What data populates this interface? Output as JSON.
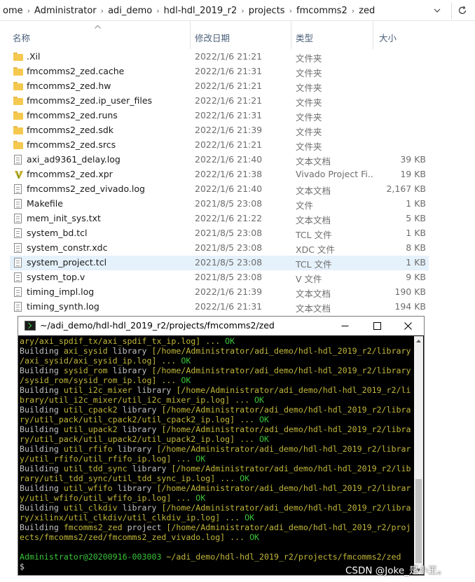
{
  "address": {
    "crumbs": [
      "ome",
      "Administrator",
      "adi_demo",
      "hdl-hdl_2019_r2",
      "projects",
      "fmcomms2",
      "zed"
    ],
    "separator": "›",
    "dropdown_icon": "chevron-down-icon",
    "refresh_icon": "refresh-icon"
  },
  "columns": {
    "name": "名称",
    "date": "修改日期",
    "type": "类型",
    "size": "大小"
  },
  "files": [
    {
      "name": ".Xil",
      "date": "2022/1/6 21:21",
      "type": "文件夹",
      "size": "",
      "icon": "folder-icon"
    },
    {
      "name": "fmcomms2_zed.cache",
      "date": "2022/1/6 21:31",
      "type": "文件夹",
      "size": "",
      "icon": "folder-icon"
    },
    {
      "name": "fmcomms2_zed.hw",
      "date": "2022/1/6 21:21",
      "type": "文件夹",
      "size": "",
      "icon": "folder-icon"
    },
    {
      "name": "fmcomms2_zed.ip_user_files",
      "date": "2022/1/6 21:21",
      "type": "文件夹",
      "size": "",
      "icon": "folder-icon"
    },
    {
      "name": "fmcomms2_zed.runs",
      "date": "2022/1/6 21:31",
      "type": "文件夹",
      "size": "",
      "icon": "folder-icon"
    },
    {
      "name": "fmcomms2_zed.sdk",
      "date": "2022/1/6 21:39",
      "type": "文件夹",
      "size": "",
      "icon": "folder-icon"
    },
    {
      "name": "fmcomms2_zed.srcs",
      "date": "2022/1/6 21:21",
      "type": "文件夹",
      "size": "",
      "icon": "folder-icon"
    },
    {
      "name": "axi_ad9361_delay.log",
      "date": "2022/1/6 21:40",
      "type": "文本文档",
      "size": "39 KB",
      "icon": "document-icon"
    },
    {
      "name": "fmcomms2_zed.xpr",
      "date": "2022/1/6 21:38",
      "type": "Vivado Project Fi...",
      "size": "19 KB",
      "icon": "vivado-icon"
    },
    {
      "name": "fmcomms2_zed_vivado.log",
      "date": "2022/1/6 21:40",
      "type": "文本文档",
      "size": "2,167 KB",
      "icon": "document-icon"
    },
    {
      "name": "Makefile",
      "date": "2021/8/5 23:08",
      "type": "文件",
      "size": "1 KB",
      "icon": "document-icon"
    },
    {
      "name": "mem_init_sys.txt",
      "date": "2022/1/6 21:22",
      "type": "文本文档",
      "size": "5 KB",
      "icon": "document-icon"
    },
    {
      "name": "system_bd.tcl",
      "date": "2021/8/5 23:08",
      "type": "TCL 文件",
      "size": "1 KB",
      "icon": "document-icon"
    },
    {
      "name": "system_constr.xdc",
      "date": "2021/8/5 23:08",
      "type": "XDC 文件",
      "size": "8 KB",
      "icon": "document-icon"
    },
    {
      "name": "system_project.tcl",
      "date": "2021/8/5 23:08",
      "type": "TCL 文件",
      "size": "1 KB",
      "icon": "document-icon",
      "selected": true
    },
    {
      "name": "system_top.v",
      "date": "2021/8/5 23:08",
      "type": "V 文件",
      "size": "9 KB",
      "icon": "document-icon"
    },
    {
      "name": "timing_impl.log",
      "date": "2022/1/6 21:39",
      "type": "文本文档",
      "size": "190 KB",
      "icon": "document-icon"
    },
    {
      "name": "timing_synth.log",
      "date": "2022/1/6 21:31",
      "type": "文本文档",
      "size": "194 KB",
      "icon": "document-icon"
    }
  ],
  "terminal": {
    "title": "~/adi_demo/hdl-hdl_2019_r2/projects/fmcomms2/zed",
    "minimize": "—",
    "maximize": "☐",
    "close": "✕",
    "lines": [
      [
        {
          "t": "ary/axi_spdif_tx/axi_spdif_tx_ip.log] ... ",
          "c": "y"
        },
        {
          "t": "OK",
          "c": "g"
        }
      ],
      [
        {
          "t": "Building ",
          "c": "b"
        },
        {
          "t": "axi_sysid ",
          "c": "y"
        },
        {
          "t": "library ",
          "c": "b"
        },
        {
          "t": "[/home/Administrator/adi_demo/hdl-hdl_2019_r2/library",
          "c": "y"
        }
      ],
      [
        {
          "t": "/axi_sysid/axi_sysid_ip.log] ... ",
          "c": "y"
        },
        {
          "t": "OK",
          "c": "g"
        }
      ],
      [
        {
          "t": "Building ",
          "c": "b"
        },
        {
          "t": "sysid_rom ",
          "c": "y"
        },
        {
          "t": "library ",
          "c": "b"
        },
        {
          "t": "[/home/Administrator/adi_demo/hdl-hdl_2019_r2/library",
          "c": "y"
        }
      ],
      [
        {
          "t": "/sysid_rom/sysid_rom_ip.log] ... ",
          "c": "y"
        },
        {
          "t": "OK",
          "c": "g"
        }
      ],
      [
        {
          "t": "Building ",
          "c": "b"
        },
        {
          "t": "util_i2c_mixer ",
          "c": "y"
        },
        {
          "t": "library ",
          "c": "b"
        },
        {
          "t": "[/home/Administrator/adi_demo/hdl-hdl_2019_r2/li",
          "c": "y"
        }
      ],
      [
        {
          "t": "brary/util_i2c_mixer/util_i2c_mixer_ip.log] ... ",
          "c": "y"
        },
        {
          "t": "OK",
          "c": "g"
        }
      ],
      [
        {
          "t": "Building ",
          "c": "b"
        },
        {
          "t": "util_cpack2 ",
          "c": "y"
        },
        {
          "t": "library ",
          "c": "b"
        },
        {
          "t": "[/home/Administrator/adi_demo/hdl-hdl_2019_r2/libra",
          "c": "y"
        }
      ],
      [
        {
          "t": "ry/util_pack/util_cpack2/util_cpack2_ip.log] ... ",
          "c": "y"
        },
        {
          "t": "OK",
          "c": "g"
        }
      ],
      [
        {
          "t": "Building ",
          "c": "b"
        },
        {
          "t": "util_upack2 ",
          "c": "y"
        },
        {
          "t": "library ",
          "c": "b"
        },
        {
          "t": "[/home/Administrator/adi_demo/hdl-hdl_2019_r2/libra",
          "c": "y"
        }
      ],
      [
        {
          "t": "ry/util_pack/util_upack2/util_upack2_ip.log] ... ",
          "c": "y"
        },
        {
          "t": "OK",
          "c": "g"
        }
      ],
      [
        {
          "t": "Building ",
          "c": "b"
        },
        {
          "t": "util_rfifo ",
          "c": "y"
        },
        {
          "t": "library ",
          "c": "b"
        },
        {
          "t": "[/home/Administrator/adi_demo/hdl-hdl_2019_r2/librar",
          "c": "y"
        }
      ],
      [
        {
          "t": "y/util_rfifo/util_rfifo_ip.log] ... ",
          "c": "y"
        },
        {
          "t": "OK",
          "c": "g"
        }
      ],
      [
        {
          "t": "Building ",
          "c": "b"
        },
        {
          "t": "util_tdd_sync ",
          "c": "y"
        },
        {
          "t": "library ",
          "c": "b"
        },
        {
          "t": "[/home/Administrator/adi_demo/hdl-hdl_2019_r2/lib",
          "c": "y"
        }
      ],
      [
        {
          "t": "rary/util_tdd_sync/util_tdd_sync_ip.log] ... ",
          "c": "y"
        },
        {
          "t": "OK",
          "c": "g"
        }
      ],
      [
        {
          "t": "Building ",
          "c": "b"
        },
        {
          "t": "util_wfifo ",
          "c": "y"
        },
        {
          "t": "library ",
          "c": "b"
        },
        {
          "t": "[/home/Administrator/adi_demo/hdl-hdl_2019_r2/librar",
          "c": "y"
        }
      ],
      [
        {
          "t": "y/util_wfifo/util_wfifo_ip.log] ... ",
          "c": "y"
        },
        {
          "t": "OK",
          "c": "g"
        }
      ],
      [
        {
          "t": "Building ",
          "c": "b"
        },
        {
          "t": "util_clkdiv ",
          "c": "y"
        },
        {
          "t": "library ",
          "c": "b"
        },
        {
          "t": "[/home/Administrator/adi_demo/hdl-hdl_2019_r2/libra",
          "c": "y"
        }
      ],
      [
        {
          "t": "ry/xilinx/util_clkdiv/util_clkdiv_ip.log] ... ",
          "c": "y"
        },
        {
          "t": "OK",
          "c": "g"
        }
      ],
      [
        {
          "t": "Building ",
          "c": "b"
        },
        {
          "t": "fmcomms2_zed ",
          "c": "y"
        },
        {
          "t": "project ",
          "c": "b"
        },
        {
          "t": "[/home/Administrator/adi_demo/hdl-hdl_2019_r2/proj",
          "c": "y"
        }
      ],
      [
        {
          "t": "ects/fmcomms2/zed/fmcomms2_zed_vivado.log] ... ",
          "c": "y"
        },
        {
          "t": "OK",
          "c": "g"
        }
      ],
      [
        {
          "t": "",
          "c": "b"
        }
      ],
      [
        {
          "t": "Administrator@20200916-003003 ",
          "c": "g"
        },
        {
          "t": "~/adi_demo/hdl-hdl_2019_r2/projects/fmcomms2/zed",
          "c": "y"
        }
      ],
      [
        {
          "t": "$",
          "c": "w"
        }
      ]
    ]
  },
  "watermark": "CSDN @Joke_是小王。"
}
